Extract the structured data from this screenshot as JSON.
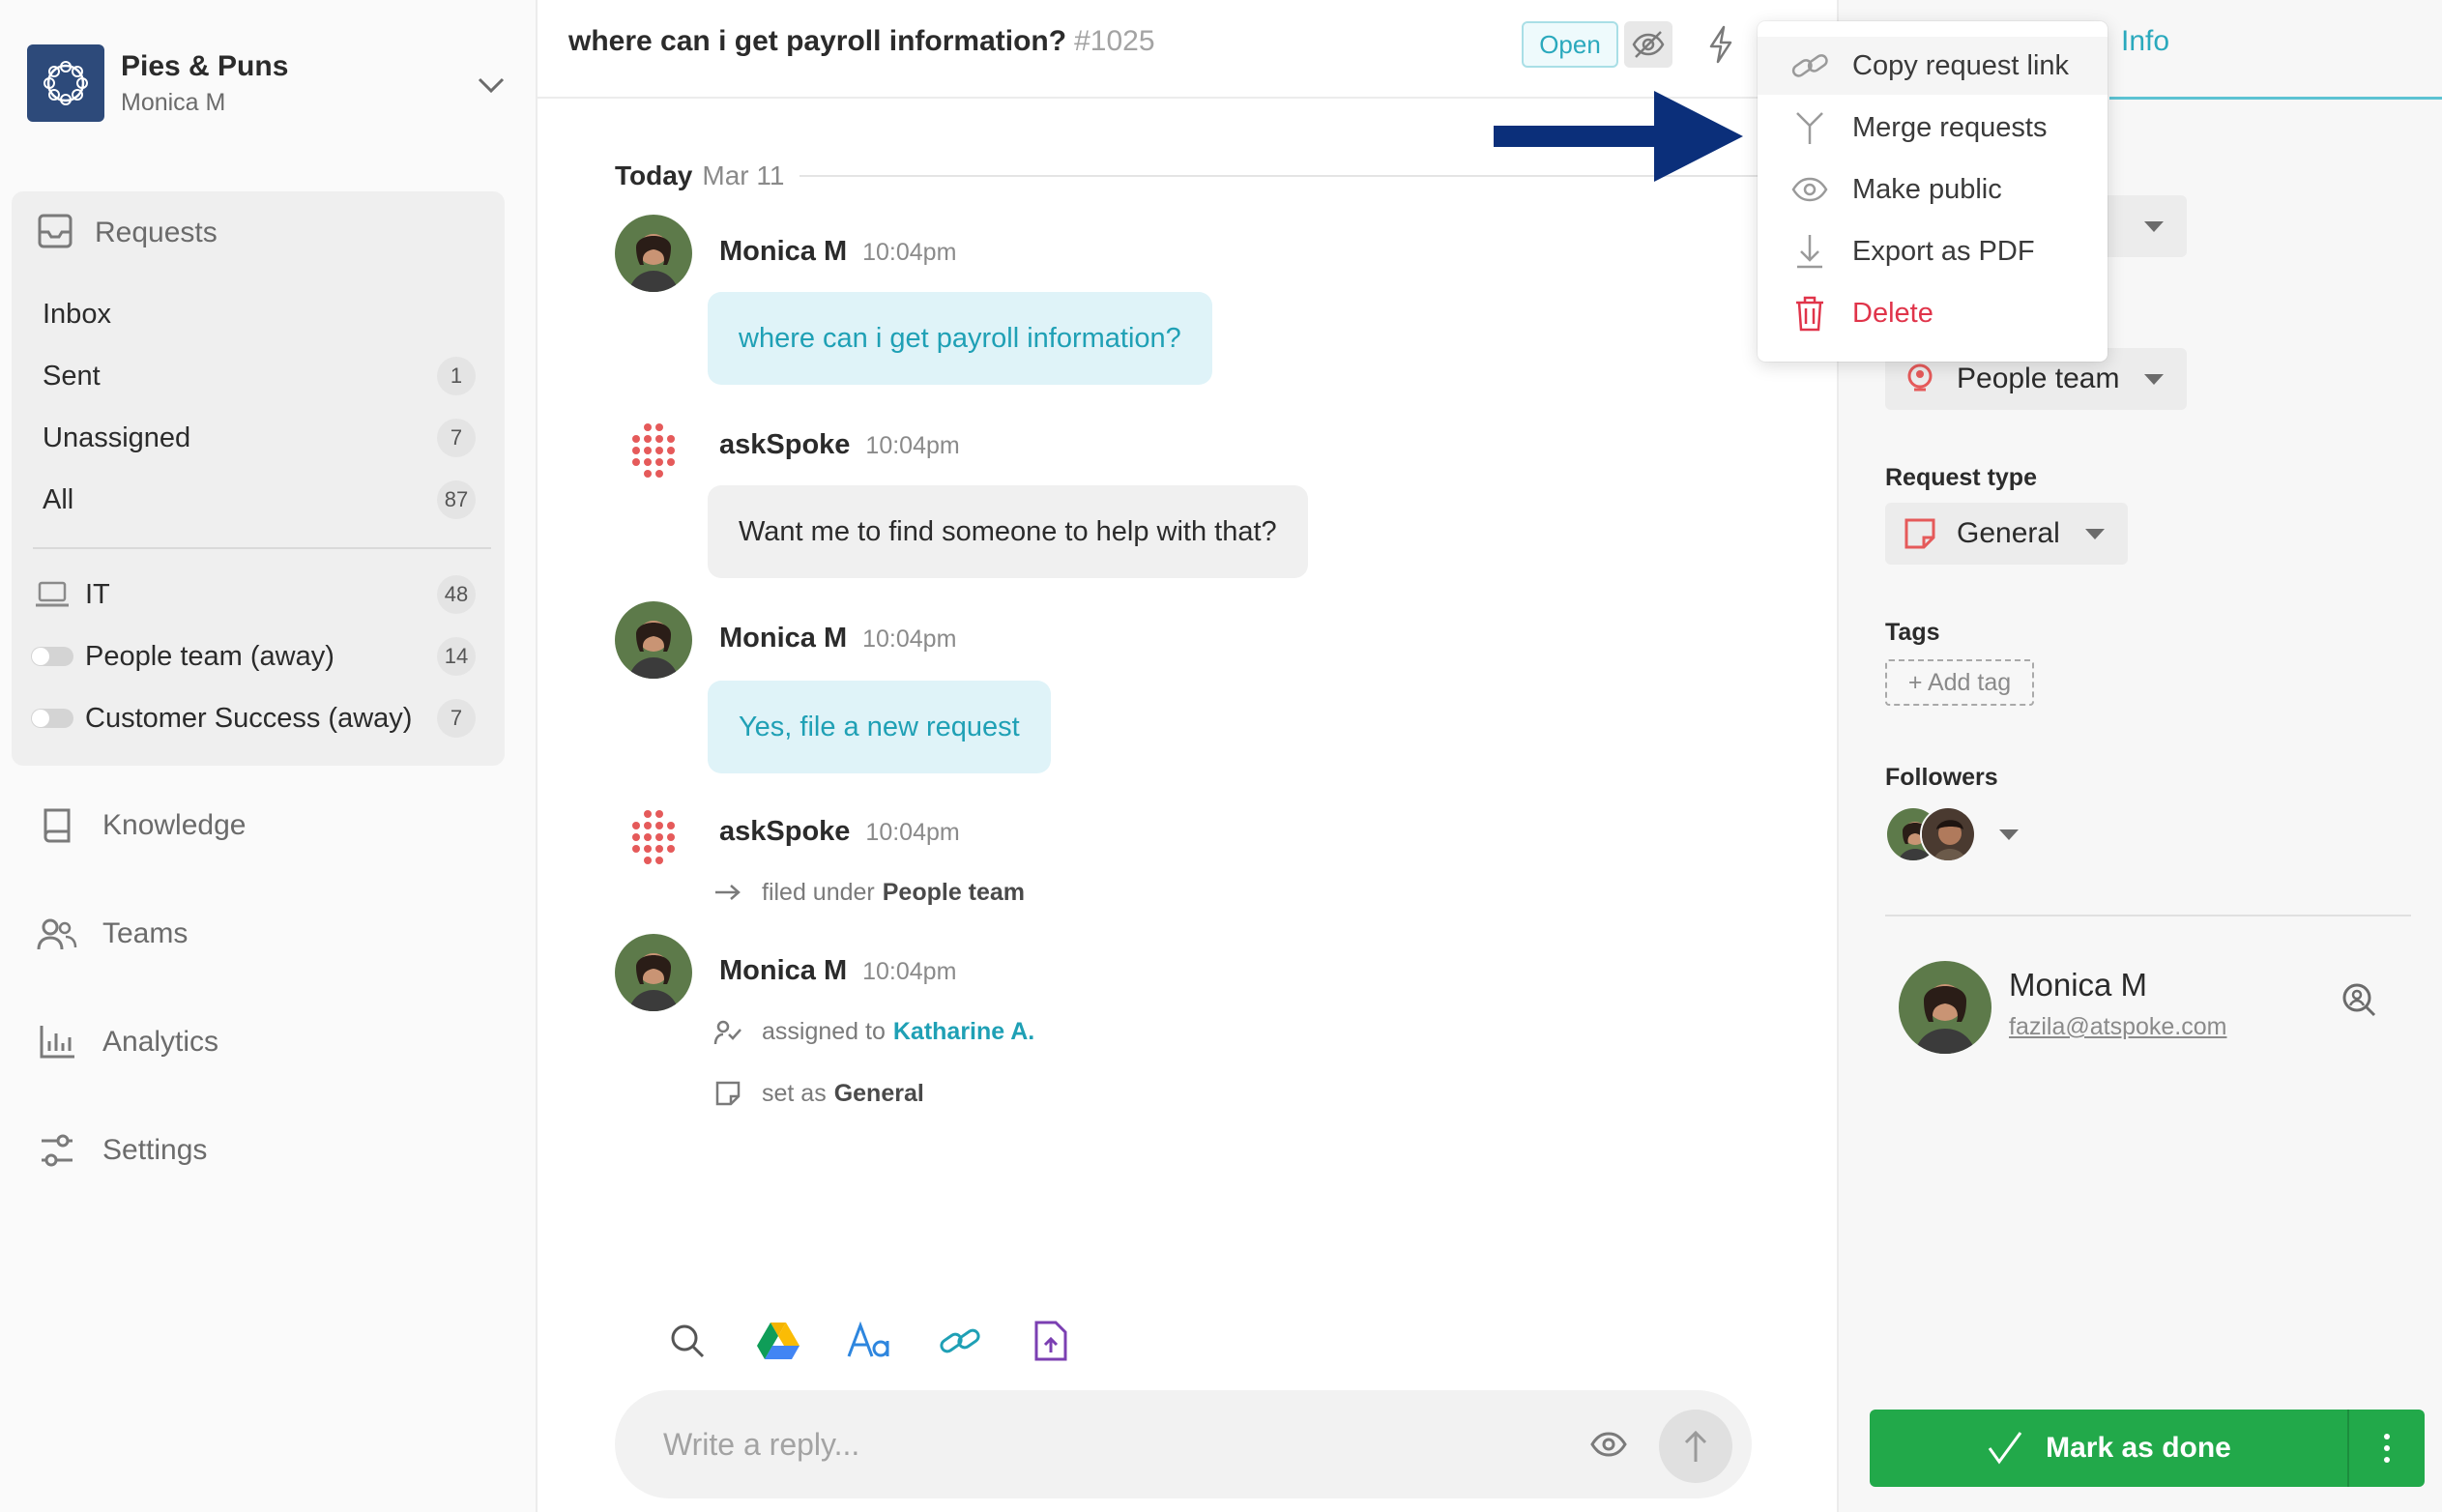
{
  "workspace": {
    "name": "Pies & Puns",
    "user": "Monica M"
  },
  "sidebar": {
    "requests_label": "Requests",
    "items": [
      {
        "label": "Inbox",
        "count": ""
      },
      {
        "label": "Sent",
        "count": "1"
      },
      {
        "label": "Unassigned",
        "count": "7"
      },
      {
        "label": "All",
        "count": "87"
      }
    ],
    "teams": [
      {
        "label": "IT",
        "count": "48",
        "icon": "laptop-icon"
      },
      {
        "label": "People team (away)",
        "count": "14",
        "icon": "toggle-off"
      },
      {
        "label": "Customer Success (away)",
        "count": "7",
        "icon": "toggle-off"
      }
    ],
    "nav": [
      {
        "label": "Knowledge",
        "icon": "book-icon"
      },
      {
        "label": "Teams",
        "icon": "people-icon"
      },
      {
        "label": "Analytics",
        "icon": "chart-icon"
      },
      {
        "label": "Settings",
        "icon": "sliders-icon"
      }
    ]
  },
  "header": {
    "title": "where can i get payroll information?",
    "number": "#1025",
    "status": "Open"
  },
  "thread": {
    "today": "Today",
    "date": "Mar 11",
    "messages": [
      {
        "author": "Monica M",
        "time": "10:04pm",
        "text": "where can i get payroll information?"
      },
      {
        "author": "askSpoke",
        "time": "10:04pm",
        "text": "Want me to find someone to help with that?"
      },
      {
        "author": "Monica M",
        "time": "10:04pm",
        "text": "Yes, file a new request"
      },
      {
        "author": "askSpoke",
        "time": "10:04pm",
        "event_text": "filed under",
        "event_target": "People team"
      },
      {
        "author": "Monica M",
        "time": "10:04pm",
        "event1_text": "assigned to",
        "event1_target": "Katharine A.",
        "event2_text": "set as",
        "event2_target": "General"
      }
    ]
  },
  "composer": {
    "placeholder": "Write a reply..."
  },
  "menu": {
    "items": [
      {
        "label": "Copy request link",
        "icon": "link-icon"
      },
      {
        "label": "Merge requests",
        "icon": "merge-icon"
      },
      {
        "label": "Make public",
        "icon": "eye-icon"
      },
      {
        "label": "Export as PDF",
        "icon": "download-icon"
      },
      {
        "label": "Delete",
        "icon": "trash-icon"
      }
    ]
  },
  "panel": {
    "tab": "Info",
    "team_value": "People team",
    "request_type_label": "Request type",
    "request_type_value": "General",
    "tags_label": "Tags",
    "add_tag": "+ Add tag",
    "followers_label": "Followers",
    "requester_name": "Monica M",
    "requester_email": "fazila@atspoke.com",
    "done_label": "Mark as done"
  },
  "colors": {
    "accent": "#2aa9bd",
    "success": "#22a94a",
    "danger": "#e0344a",
    "arrow": "#0b2f7a",
    "brand_logo": "#2d4a7a"
  }
}
